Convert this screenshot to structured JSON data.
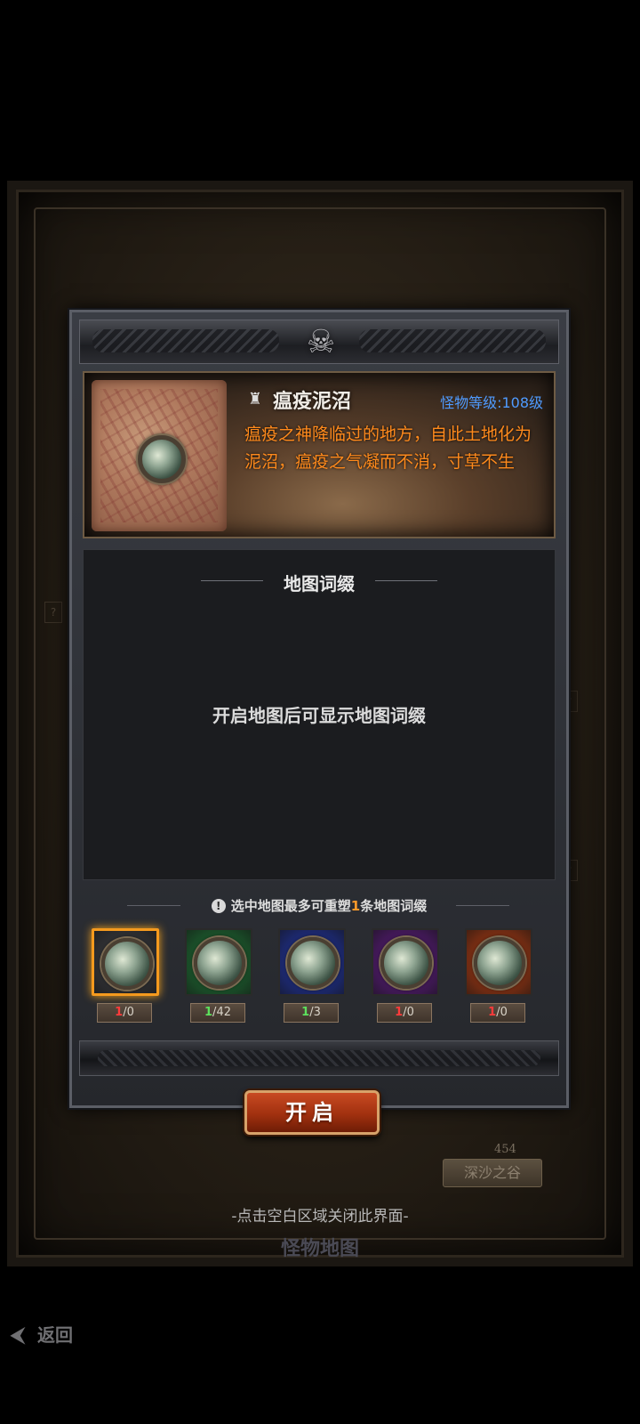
{
  "background": {
    "map_label": "深沙之谷",
    "map_number": "454",
    "bottom_title": "怪物地图"
  },
  "dialog": {
    "map_name": "瘟疫泥沼",
    "monster_level": "怪物等级:108级",
    "description": "瘟疫之神降临过的地方，自此土地化为泥沼，瘟疫之气凝而不消，寸草不生",
    "affix_title": "地图词缀",
    "affix_empty_text": "开启地图后可显示地图词缀",
    "reshape_hint_pre": "选中地图最多可重塑",
    "reshape_hint_num": "1",
    "reshape_hint_post": "条地图词缀",
    "slots": [
      {
        "rarity": "white",
        "color": "#3b3c40",
        "border": "#f59a1e",
        "have": "1",
        "need": "0",
        "have_color": "red"
      },
      {
        "rarity": "green",
        "color": "#1f6b34",
        "border": "#2a2a2a",
        "have": "1",
        "need": "42",
        "have_color": "green"
      },
      {
        "rarity": "blue",
        "color": "#22349a",
        "border": "#2a2a2a",
        "have": "1",
        "need": "3",
        "have_color": "green"
      },
      {
        "rarity": "purple",
        "color": "#5a1d7a",
        "border": "#2a2a2a",
        "have": "1",
        "need": "0",
        "have_color": "red"
      },
      {
        "rarity": "orange",
        "color": "#a43a14",
        "border": "#2a2a2a",
        "have": "1",
        "need": "0",
        "have_color": "red"
      }
    ],
    "open_button": "开启"
  },
  "dismiss_hint": "-点击空白区域关闭此界面-",
  "back_button": "返回",
  "icons": {
    "skull": "skull-icon",
    "map_type": "map-type-icon",
    "hint": "exclamation-icon",
    "back": "back-arrow-icon"
  }
}
